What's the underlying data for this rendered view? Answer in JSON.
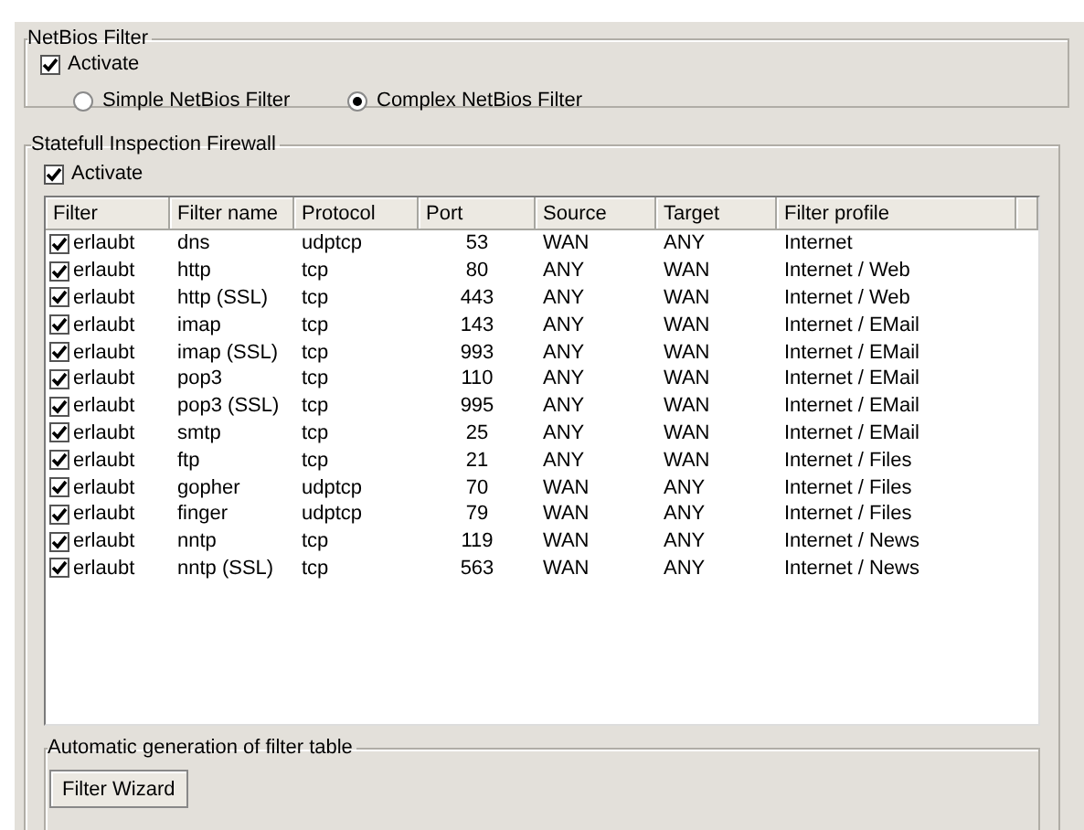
{
  "netbios_filter": {
    "title": "NetBios Filter",
    "activate": {
      "label": "Activate",
      "checked": true
    },
    "modes": [
      {
        "label": "Simple NetBios Filter",
        "selected": false
      },
      {
        "label": "Complex NetBios Filter",
        "selected": true
      }
    ]
  },
  "firewall": {
    "title": "Statefull Inspection Firewall",
    "activate": {
      "label": "Activate",
      "checked": true
    },
    "table": {
      "columns": [
        "Filter",
        "Filter name",
        "Protocol",
        "Port",
        "Source",
        "Target",
        "Filter profile"
      ],
      "rows": [
        {
          "checked": true,
          "filter": "erlaubt",
          "name": "dns",
          "protocol": "udptcp",
          "port": "53",
          "source": "WAN",
          "target": "ANY",
          "profile": "Internet"
        },
        {
          "checked": true,
          "filter": "erlaubt",
          "name": "http",
          "protocol": "tcp",
          "port": "80",
          "source": "ANY",
          "target": "WAN",
          "profile": "Internet / Web"
        },
        {
          "checked": true,
          "filter": "erlaubt",
          "name": "http (SSL)",
          "protocol": "tcp",
          "port": "443",
          "source": "ANY",
          "target": "WAN",
          "profile": "Internet / Web"
        },
        {
          "checked": true,
          "filter": "erlaubt",
          "name": "imap",
          "protocol": "tcp",
          "port": "143",
          "source": "ANY",
          "target": "WAN",
          "profile": "Internet / EMail"
        },
        {
          "checked": true,
          "filter": "erlaubt",
          "name": "imap (SSL)",
          "protocol": "tcp",
          "port": "993",
          "source": "ANY",
          "target": "WAN",
          "profile": "Internet / EMail"
        },
        {
          "checked": true,
          "filter": "erlaubt",
          "name": "pop3",
          "protocol": "tcp",
          "port": "110",
          "source": "ANY",
          "target": "WAN",
          "profile": "Internet / EMail"
        },
        {
          "checked": true,
          "filter": "erlaubt",
          "name": "pop3 (SSL)",
          "protocol": "tcp",
          "port": "995",
          "source": "ANY",
          "target": "WAN",
          "profile": "Internet / EMail"
        },
        {
          "checked": true,
          "filter": "erlaubt",
          "name": "smtp",
          "protocol": "tcp",
          "port": "25",
          "source": "ANY",
          "target": "WAN",
          "profile": "Internet / EMail"
        },
        {
          "checked": true,
          "filter": "erlaubt",
          "name": "ftp",
          "protocol": "tcp",
          "port": "21",
          "source": "ANY",
          "target": "WAN",
          "profile": "Internet / Files"
        },
        {
          "checked": true,
          "filter": "erlaubt",
          "name": "gopher",
          "protocol": "udptcp",
          "port": "70",
          "source": "WAN",
          "target": "ANY",
          "profile": "Internet / Files"
        },
        {
          "checked": true,
          "filter": "erlaubt",
          "name": "finger",
          "protocol": "udptcp",
          "port": "79",
          "source": "WAN",
          "target": "ANY",
          "profile": "Internet / Files"
        },
        {
          "checked": true,
          "filter": "erlaubt",
          "name": "nntp",
          "protocol": "tcp",
          "port": "119",
          "source": "WAN",
          "target": "ANY",
          "profile": "Internet / News"
        },
        {
          "checked": true,
          "filter": "erlaubt",
          "name": "nntp (SSL)",
          "protocol": "tcp",
          "port": "563",
          "source": "WAN",
          "target": "ANY",
          "profile": "Internet / News"
        }
      ]
    },
    "auto_generation": {
      "title": "Automatic generation of filter table",
      "button": "Filter Wizard"
    }
  }
}
